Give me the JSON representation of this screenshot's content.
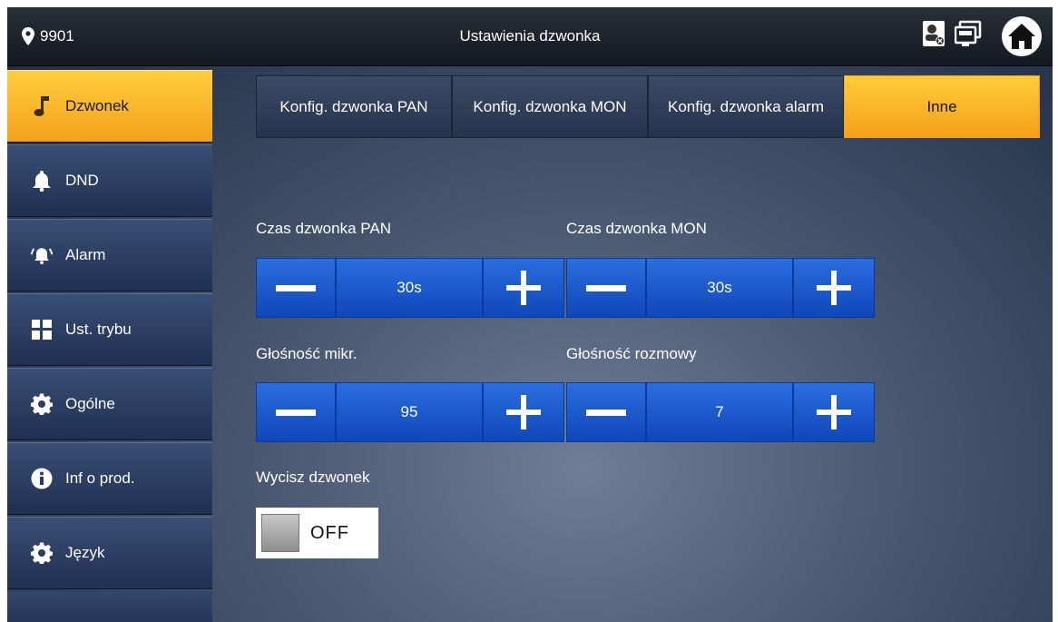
{
  "topbar": {
    "location": "9901",
    "title": "Ustawienia dzwonka",
    "icons": [
      "location-pin-icon",
      "contact-icon",
      "monitor-icon",
      "home-icon"
    ]
  },
  "sidebar": {
    "items": [
      {
        "label": "Dzwonek",
        "icon": "music-note-icon",
        "active": true
      },
      {
        "label": "DND",
        "icon": "bell-icon"
      },
      {
        "label": "Alarm",
        "icon": "alarm-icon"
      },
      {
        "label": "Ust. trybu",
        "icon": "mode-grid-icon"
      },
      {
        "label": "Ogólne",
        "icon": "gear-icon"
      },
      {
        "label": "Inf o prod.",
        "icon": "info-icon"
      },
      {
        "label": "Język",
        "icon": "gear-icon"
      }
    ]
  },
  "tabs": [
    {
      "label": "Konfig. dzwonka PAN"
    },
    {
      "label": "Konfig. dzwonka MON"
    },
    {
      "label": "Konfig. dzwonka alarm"
    },
    {
      "label": "Inne",
      "active": true
    }
  ],
  "settings": {
    "pan_ring_time": {
      "label": "Czas dzwonka PAN",
      "value": "30s"
    },
    "mon_ring_time": {
      "label": "Czas dzwonka MON",
      "value": "30s"
    },
    "mic_volume": {
      "label": "Głośność mikr.",
      "value": "95"
    },
    "talk_volume": {
      "label": "Głośność rozmowy",
      "value": "7"
    },
    "mute_ring": {
      "label": "Wycisz dzwonek",
      "state": "OFF"
    }
  },
  "colors": {
    "accent": "#f9b52a",
    "button_blue": "#1d5ad0",
    "sidebar": "#2b3d5f"
  }
}
